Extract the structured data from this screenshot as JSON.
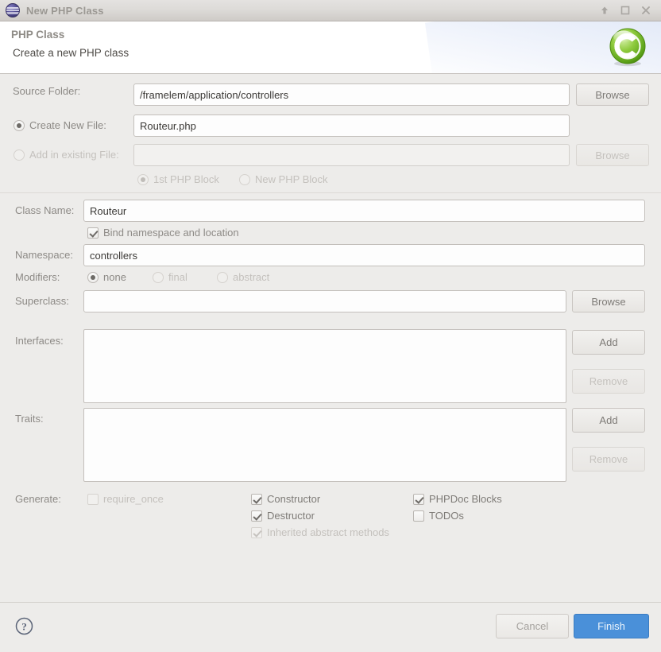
{
  "window": {
    "title": "New PHP Class",
    "icon": "php-class-icon",
    "controls": [
      {
        "name": "shade-button",
        "icon": "arrow-up-icon"
      },
      {
        "name": "maximize-button",
        "icon": "square-icon"
      },
      {
        "name": "close-button",
        "icon": "close-x-icon"
      }
    ]
  },
  "header": {
    "title": "PHP Class",
    "subtitle": "Create a new PHP class",
    "logo": "green-c-badge-icon"
  },
  "form": {
    "source_folder": {
      "label": "Source Folder:",
      "value": "/framelem/application/controllers",
      "browse_label": "Browse",
      "browse_enabled": true
    },
    "create_new_file": {
      "label": "Create New File:",
      "selected": true,
      "value": "Routeur.php"
    },
    "add_existing_file": {
      "label": "Add in existing File:",
      "selected": false,
      "enabled": false,
      "value": "",
      "browse_label": "Browse",
      "browse_enabled": false
    },
    "php_block": {
      "first": {
        "label": "1st PHP Block",
        "selected": true,
        "enabled": false
      },
      "new": {
        "label": "New PHP Block",
        "selected": false,
        "enabled": false
      }
    },
    "class_name": {
      "label": "Class Name:",
      "value": "Routeur"
    },
    "bind_namespace": {
      "label": "Bind namespace and location",
      "checked": true
    },
    "namespace": {
      "label": "Namespace:",
      "value": "controllers"
    },
    "modifiers": {
      "label": "Modifiers:",
      "options": [
        {
          "label": "none",
          "selected": true,
          "enabled": true
        },
        {
          "label": "final",
          "selected": false,
          "enabled": false
        },
        {
          "label": "abstract",
          "selected": false,
          "enabled": false
        }
      ]
    },
    "superclass": {
      "label": "Superclass:",
      "value": "",
      "browse_label": "Browse",
      "browse_enabled": true
    },
    "interfaces": {
      "label": "Interfaces:",
      "items": [],
      "add_label": "Add",
      "remove_label": "Remove",
      "remove_enabled": false
    },
    "traits": {
      "label": "Traits:",
      "items": [],
      "add_label": "Add",
      "remove_label": "Remove",
      "remove_enabled": false
    },
    "generate": {
      "label": "Generate:",
      "column1": [
        {
          "label": "require_once",
          "checked": false,
          "enabled": false
        }
      ],
      "column2": [
        {
          "label": "Constructor",
          "checked": true,
          "enabled": true
        },
        {
          "label": "Destructor",
          "checked": true,
          "enabled": true
        },
        {
          "label": "Inherited abstract methods",
          "checked": true,
          "enabled": false
        }
      ],
      "column3": [
        {
          "label": "PHPDoc Blocks",
          "checked": true,
          "enabled": true
        },
        {
          "label": "TODOs",
          "checked": false,
          "enabled": true
        }
      ]
    }
  },
  "footer": {
    "help_icon": "question-mark-icon",
    "cancel_label": "Cancel",
    "finish_label": "Finish"
  },
  "colors": {
    "primary_button": "#4a90d9",
    "window_background": "#edecea",
    "header_background": "#ffffff",
    "label_text": "#8d8a86",
    "value_text": "#3b3936",
    "disabled_text": "#c4c1bd"
  }
}
